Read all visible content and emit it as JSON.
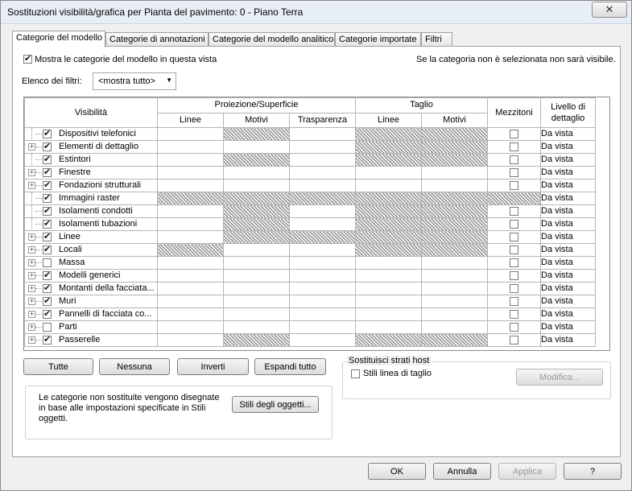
{
  "window": {
    "title": "Sostituzioni visibilità/grafica per Pianta del pavimento: 0 - Piano Terra",
    "close_symbol": "✕"
  },
  "tabs": [
    {
      "label": "Categorie del modello",
      "active": true
    },
    {
      "label": "Categorie di annotazioni",
      "active": false
    },
    {
      "label": "Categorie del modello analitico",
      "active": false
    },
    {
      "label": "Categorie importate",
      "active": false
    },
    {
      "label": "Filtri",
      "active": false
    }
  ],
  "show_model_categories": {
    "label": "Mostra le categorie del modello in questa vista",
    "checked": true
  },
  "hint_text": "Se la categoria non è selezionata non sarà visibile.",
  "filter_list": {
    "label": "Elenco dei filtri:",
    "value": "<mostra tutto>"
  },
  "grid": {
    "headers": {
      "visibility": "Visibilità",
      "projection_surface": "Proiezione/Superficie",
      "cut": "Taglio",
      "halftone": "Mezzitoni",
      "detail_level_1": "Livello di",
      "detail_level_2": "dettaglio",
      "lines": "Linee",
      "patterns": "Motivi",
      "transparency": "Trasparenza",
      "cut_lines": "Linee",
      "cut_patterns": "Motivi"
    },
    "rows": [
      {
        "name": "Dispositivi telefonici",
        "checked": true,
        "expandable": false,
        "detail": "Da vista",
        "hatch": [
          false,
          true,
          false,
          true,
          true
        ],
        "halftone_available": true
      },
      {
        "name": "Elementi di dettaglio",
        "checked": true,
        "expandable": true,
        "detail": "Da vista",
        "hatch": [
          false,
          false,
          false,
          true,
          true
        ],
        "halftone_available": true
      },
      {
        "name": "Estintori",
        "checked": true,
        "expandable": false,
        "detail": "Da vista",
        "hatch": [
          false,
          true,
          false,
          true,
          true
        ],
        "halftone_available": true
      },
      {
        "name": "Finestre",
        "checked": true,
        "expandable": true,
        "detail": "Da vista",
        "hatch": [
          false,
          false,
          false,
          false,
          false
        ],
        "halftone_available": true
      },
      {
        "name": "Fondazioni strutturali",
        "checked": true,
        "expandable": true,
        "detail": "Da vista",
        "hatch": [
          false,
          false,
          false,
          false,
          false
        ],
        "halftone_available": true
      },
      {
        "name": "Immagini raster",
        "checked": true,
        "expandable": false,
        "detail": "Da vista",
        "hatch": [
          true,
          true,
          true,
          true,
          true
        ],
        "halftone_available": false
      },
      {
        "name": "Isolamenti condotti",
        "checked": true,
        "expandable": false,
        "detail": "Da vista",
        "hatch": [
          false,
          true,
          false,
          true,
          true
        ],
        "halftone_available": true
      },
      {
        "name": "Isolamenti tubazioni",
        "checked": true,
        "expandable": false,
        "detail": "Da vista",
        "hatch": [
          false,
          true,
          false,
          true,
          true
        ],
        "halftone_available": true
      },
      {
        "name": "Linee",
        "checked": true,
        "expandable": true,
        "detail": "Da vista",
        "hatch": [
          false,
          true,
          true,
          true,
          true
        ],
        "halftone_available": true
      },
      {
        "name": "Locali",
        "checked": true,
        "expandable": true,
        "detail": "Da vista",
        "hatch": [
          true,
          false,
          false,
          true,
          true
        ],
        "halftone_available": true
      },
      {
        "name": "Massa",
        "checked": false,
        "expandable": true,
        "detail": "Da vista",
        "hatch": [
          false,
          false,
          false,
          false,
          false
        ],
        "halftone_available": true
      },
      {
        "name": "Modelli generici",
        "checked": true,
        "expandable": true,
        "detail": "Da vista",
        "hatch": [
          false,
          false,
          false,
          false,
          false
        ],
        "halftone_available": true
      },
      {
        "name": "Montanti della facciata...",
        "checked": true,
        "expandable": true,
        "detail": "Da vista",
        "hatch": [
          false,
          false,
          false,
          false,
          false
        ],
        "halftone_available": true
      },
      {
        "name": "Muri",
        "checked": true,
        "expandable": true,
        "detail": "Da vista",
        "hatch": [
          false,
          false,
          false,
          false,
          false
        ],
        "halftone_available": true
      },
      {
        "name": "Pannelli di facciata co...",
        "checked": true,
        "expandable": true,
        "detail": "Da vista",
        "hatch": [
          false,
          false,
          false,
          false,
          false
        ],
        "halftone_available": true
      },
      {
        "name": "Parti",
        "checked": false,
        "expandable": true,
        "detail": "Da vista",
        "hatch": [
          false,
          false,
          false,
          false,
          false
        ],
        "halftone_available": true
      },
      {
        "name": "Passerelle",
        "checked": true,
        "expandable": true,
        "detail": "Da vista",
        "hatch": [
          false,
          true,
          false,
          true,
          true
        ],
        "halftone_available": true
      }
    ],
    "scroll_up_symbol": "▲",
    "scroll_down_symbol": "▼"
  },
  "buttons": {
    "all": "Tutte",
    "none": "Nessuna",
    "invert": "Inverti",
    "expand_all": "Espandi tutto"
  },
  "info_text": "Le categorie non sostituite vengono disegnate in base alle impostazioni specificate in Stili oggetti.",
  "object_styles_button": "Stili degli oggetti...",
  "host_layers": {
    "title": "Sostituisci strati host",
    "cut_line_styles": "Stili linea di taglio",
    "cut_line_styles_checked": false,
    "edit_button": "Modifica..."
  },
  "footer": {
    "ok": "OK",
    "cancel": "Annulla",
    "apply": "Applica",
    "help": "?"
  }
}
